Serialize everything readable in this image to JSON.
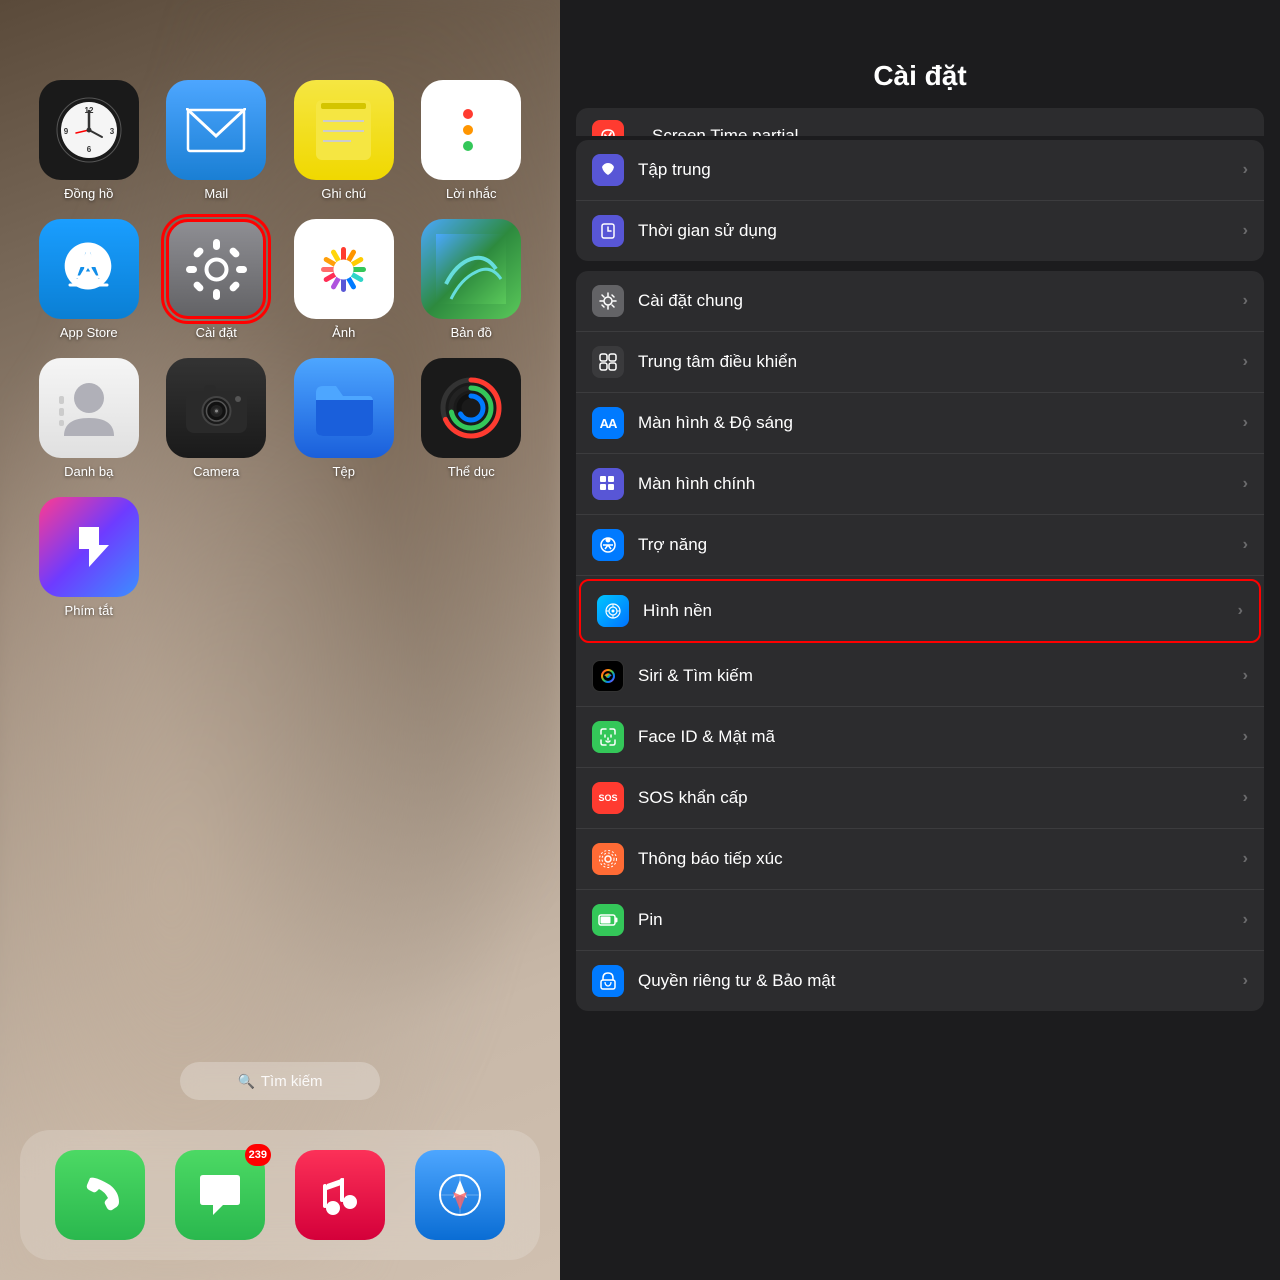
{
  "left": {
    "apps": [
      {
        "id": "clock",
        "label": "Đồng hồ",
        "icon": "clock",
        "highlighted": false
      },
      {
        "id": "mail",
        "label": "Mail",
        "icon": "mail",
        "highlighted": false
      },
      {
        "id": "notes",
        "label": "Ghi chú",
        "icon": "notes",
        "highlighted": false
      },
      {
        "id": "reminders",
        "label": "Lời nhắc",
        "icon": "reminders",
        "highlighted": false
      },
      {
        "id": "appstore",
        "label": "App Store",
        "icon": "appstore",
        "highlighted": false
      },
      {
        "id": "settings",
        "label": "Cài đặt",
        "icon": "settings",
        "highlighted": true
      },
      {
        "id": "photos",
        "label": "Ảnh",
        "icon": "photos",
        "highlighted": false
      },
      {
        "id": "maps",
        "label": "Bản đồ",
        "icon": "maps",
        "highlighted": false
      },
      {
        "id": "contacts",
        "label": "Danh bạ",
        "icon": "contacts",
        "highlighted": false
      },
      {
        "id": "camera",
        "label": "Camera",
        "icon": "camera",
        "highlighted": false
      },
      {
        "id": "files",
        "label": "Tệp",
        "icon": "files",
        "highlighted": false
      },
      {
        "id": "fitness",
        "label": "Thể dục",
        "icon": "fitness",
        "highlighted": false
      },
      {
        "id": "shortcuts",
        "label": "Phím tắt",
        "icon": "shortcuts",
        "highlighted": false
      }
    ],
    "search_label": "Tìm kiếm",
    "dock": [
      {
        "id": "phone",
        "label": "Phone",
        "badge": null
      },
      {
        "id": "messages",
        "label": "Messages",
        "badge": "239"
      },
      {
        "id": "music",
        "label": "Music",
        "badge": null
      },
      {
        "id": "safari",
        "label": "Safari",
        "badge": null
      }
    ]
  },
  "right": {
    "title": "Cài đặt",
    "sections": [
      {
        "id": "focus-screen-time",
        "rows": [
          {
            "id": "focus",
            "label": "Tập trung",
            "icon_bg": "bg-purple",
            "icon": "moon"
          },
          {
            "id": "screen-time",
            "label": "Thời gian sử dụng",
            "icon_bg": "bg-purple",
            "icon": "hourglass"
          }
        ]
      },
      {
        "id": "general-controls",
        "rows": [
          {
            "id": "general",
            "label": "Cài đặt chung",
            "icon_bg": "bg-gray",
            "icon": "gear"
          },
          {
            "id": "control-center",
            "label": "Trung tâm điều khiển",
            "icon_bg": "bg-dark-gray",
            "icon": "sliders"
          },
          {
            "id": "display",
            "label": "Màn hình & Độ sáng",
            "icon_bg": "bg-blue2",
            "icon": "AA"
          },
          {
            "id": "home-screen",
            "label": "Màn hình chính",
            "icon_bg": "bg-indigo",
            "icon": "grid"
          },
          {
            "id": "accessibility",
            "label": "Trợ năng",
            "icon_bg": "bg-blue",
            "icon": "accessibility"
          },
          {
            "id": "wallpaper",
            "label": "Hình nền",
            "icon_bg": "bg-wallpaper",
            "icon": "flower",
            "highlighted": true
          },
          {
            "id": "siri",
            "label": "Siri & Tìm kiếm",
            "icon_bg": "bg-siri",
            "icon": "siri"
          },
          {
            "id": "faceid",
            "label": "Face ID & Mật mã",
            "icon_bg": "bg-green",
            "icon": "faceid"
          },
          {
            "id": "sos",
            "label": "SOS khẩn cấp",
            "icon_bg": "bg-red",
            "icon": "sos"
          },
          {
            "id": "contact-exposure",
            "label": "Thông báo tiếp xúc",
            "icon_bg": "bg-contact",
            "icon": "contact-tracing"
          },
          {
            "id": "battery",
            "label": "Pin",
            "icon_bg": "bg-battery",
            "icon": "battery"
          },
          {
            "id": "privacy",
            "label": "Quyền riêng tư & Bảo mật",
            "icon_bg": "bg-privacy",
            "icon": "hand"
          }
        ]
      }
    ]
  }
}
